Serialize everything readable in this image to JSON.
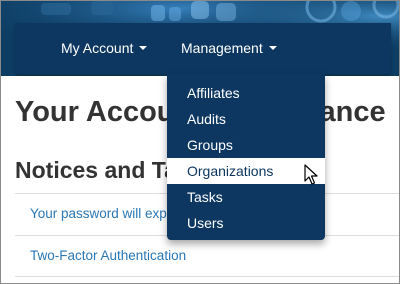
{
  "navbar": {
    "items": [
      {
        "label": "My Account"
      },
      {
        "label": "Management"
      }
    ]
  },
  "main": {
    "title": "Your Account Maintenance",
    "section_title": "Notices and Tasks",
    "notices": [
      {
        "label": "Your password will expire"
      },
      {
        "label": "Two-Factor Authentication"
      }
    ]
  },
  "dropdown": {
    "items": [
      {
        "label": "Affiliates"
      },
      {
        "label": "Audits"
      },
      {
        "label": "Groups"
      },
      {
        "label": "Organizations",
        "highlighted": true
      },
      {
        "label": "Tasks"
      },
      {
        "label": "Users"
      }
    ]
  },
  "colors": {
    "navbar": "#0d3760",
    "banner": "#0d3d63",
    "link": "#2a77b5",
    "text": "#333333"
  },
  "icons": [
    "caret-down-icon",
    "mouse-pointer-icon"
  ]
}
